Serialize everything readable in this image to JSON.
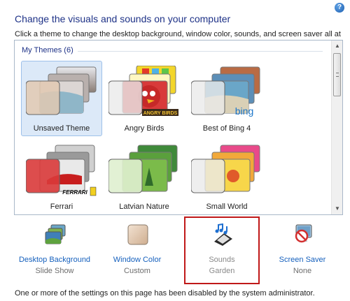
{
  "help": {
    "glyph": "?"
  },
  "header": {
    "title": "Change the visuals and sounds on your computer",
    "subtitle": "Click a theme to change the desktop background, window color, sounds, and screen saver all at once."
  },
  "themes": {
    "group_label": "My Themes (6)",
    "items": [
      {
        "label": "Unsaved Theme",
        "selected": true,
        "glass_color": "#e2c9b2"
      },
      {
        "label": "Angry Birds",
        "selected": false,
        "glass_color": "#eaeaea",
        "logo": "ANGRY BIRDS"
      },
      {
        "label": "Best of Bing 4",
        "selected": false,
        "glass_color": "#eaeaea",
        "logo": "bing"
      },
      {
        "label": "Ferrari",
        "selected": false,
        "glass_color": "#d93a3a",
        "logo": "FERRARI"
      },
      {
        "label": "Latvian Nature",
        "selected": false,
        "glass_color": "#dff0cf"
      },
      {
        "label": "Small World",
        "selected": false,
        "glass_color": "#eaeaea"
      }
    ]
  },
  "settings": [
    {
      "title": "Desktop Background",
      "subtitle": "Slide Show",
      "icon": "desktop-background-icon",
      "enabled": true
    },
    {
      "title": "Window Color",
      "subtitle": "Custom",
      "icon": "window-color-icon",
      "enabled": true
    },
    {
      "title": "Sounds",
      "subtitle": "Garden",
      "icon": "sounds-icon",
      "enabled": false
    },
    {
      "title": "Screen Saver",
      "subtitle": "None",
      "icon": "screen-saver-icon",
      "enabled": true
    }
  ],
  "footer": {
    "note": "One or more of the settings on this page has been disabled by the system administrator."
  },
  "colors": {
    "link": "#1560bd",
    "title": "#1e3287",
    "highlight_border": "#c01818",
    "selected_bg": "#dce9f8"
  }
}
